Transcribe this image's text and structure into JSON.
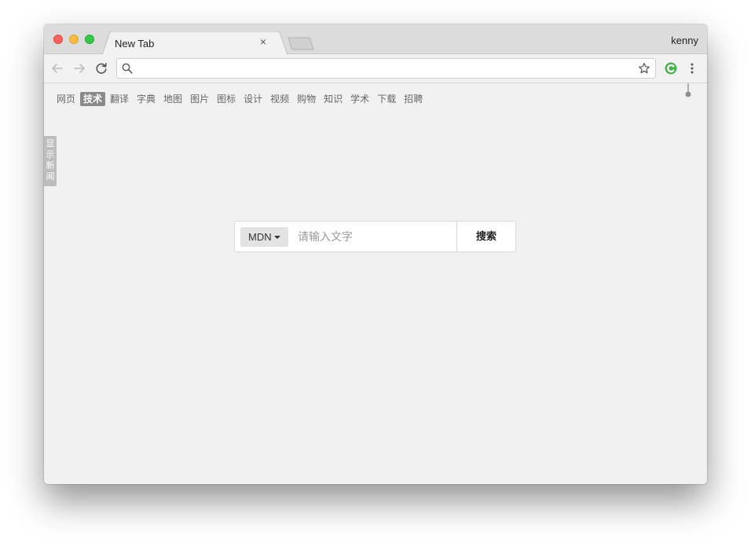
{
  "browser": {
    "tab_title": "New Tab",
    "tab_close": "×",
    "profile_name": "kenny",
    "address_value": "",
    "address_placeholder": ""
  },
  "categories": [
    {
      "label": "网页",
      "active": false
    },
    {
      "label": "技术",
      "active": true
    },
    {
      "label": "翻译",
      "active": false
    },
    {
      "label": "字典",
      "active": false
    },
    {
      "label": "地图",
      "active": false
    },
    {
      "label": "图片",
      "active": false
    },
    {
      "label": "图标",
      "active": false
    },
    {
      "label": "设计",
      "active": false
    },
    {
      "label": "视频",
      "active": false
    },
    {
      "label": "购物",
      "active": false
    },
    {
      "label": "知识",
      "active": false
    },
    {
      "label": "学术",
      "active": false
    },
    {
      "label": "下载",
      "active": false
    },
    {
      "label": "招聘",
      "active": false
    }
  ],
  "news_toggle": {
    "label": "显示新闻"
  },
  "search": {
    "engine": "MDN",
    "placeholder": "请输入文字",
    "button_label": "搜索"
  },
  "colors": {
    "active_category": "#8a8a8a",
    "extension_icon": "#4caf50"
  },
  "icons": [
    "back-arrow-icon",
    "forward-arrow-icon",
    "reload-icon",
    "search-icon",
    "star-icon",
    "extension-icon",
    "menu-dots-icon",
    "pin-icon",
    "caret-down-icon"
  ]
}
